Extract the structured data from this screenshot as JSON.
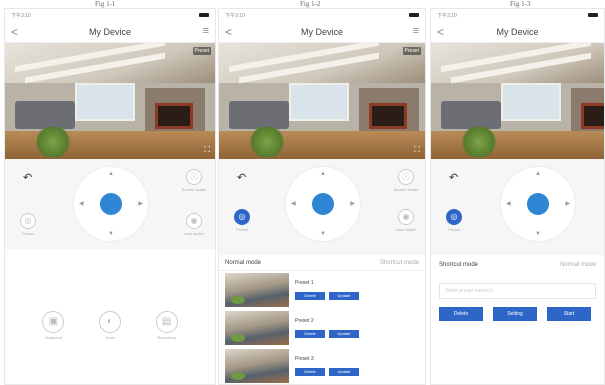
{
  "figures": [
    "Fig 1-1",
    "Fig 1-2",
    "Fig 1-3"
  ],
  "status": {
    "time": "下午3:10",
    "signal": "..."
  },
  "nav": {
    "title": "My Device",
    "back": "<",
    "menu": "≡"
  },
  "video": {
    "badge": "Preset",
    "fullscreen": "⛶"
  },
  "controls": {
    "undo": "↶",
    "up": "▲",
    "down": "▼",
    "left": "◀",
    "right": "▶",
    "screenshot_side": "Screen shade",
    "preset": "Preset",
    "lens": "Lens switch"
  },
  "bottom": {
    "snapshot": "Snapshot",
    "voice": "Voice",
    "recording": "Recording"
  },
  "preset_list": {
    "mode": "Normal mode",
    "shortcut": "Shortcut mode",
    "items": [
      {
        "name": "Preset 1",
        "delete": "Delete",
        "update": "Update"
      },
      {
        "name": "Preset 2",
        "delete": "Delete",
        "update": "Update"
      },
      {
        "name": "Preset 3",
        "delete": "Delete",
        "update": "Update"
      }
    ]
  },
  "shortcut_panel": {
    "mode": "Shortcut mode",
    "normal": "Normal mode",
    "placeholder": "Enter preset name(s)",
    "delete": "Delete",
    "setting": "Setting",
    "start": "Start"
  }
}
